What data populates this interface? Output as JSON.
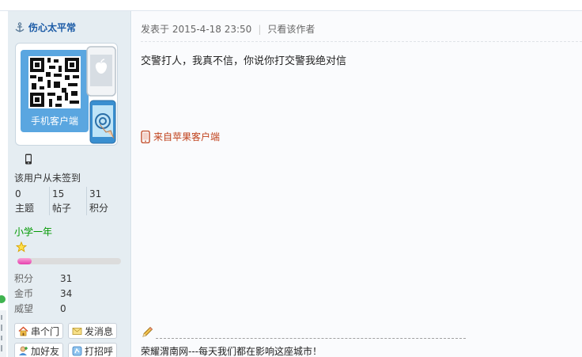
{
  "author": {
    "name": "伤心太平常",
    "icon": "anchor-icon"
  },
  "qr": {
    "label": "手机客户端"
  },
  "user": {
    "signin_text": "该用户从未签到",
    "stats": [
      {
        "value": "0",
        "label": "主题"
      },
      {
        "value": "15",
        "label": "帖子"
      },
      {
        "value": "31",
        "label": "积分"
      }
    ],
    "rank": "小学一年",
    "progress_fraction": 0.14,
    "info": [
      {
        "key": "积分",
        "value": "31"
      },
      {
        "key": "金币",
        "value": "34"
      },
      {
        "key": "威望",
        "value": "0"
      }
    ],
    "buttons": [
      {
        "label": "串个门",
        "icon": "home-icon"
      },
      {
        "label": "发消息",
        "icon": "message-icon"
      },
      {
        "label": "加好友",
        "icon": "add-friend-icon"
      },
      {
        "label": "打招呼",
        "icon": "greet-icon"
      }
    ]
  },
  "post": {
    "posted_at": "发表于 2015-4-18 23:50",
    "separator": "|",
    "only_author": "只看该作者",
    "content": "交警打人，我真不信，你说你打交警我绝对信",
    "from_client": "来自苹果客户端",
    "signature": "荣耀渭南网---每天我们都在影响这座城市！"
  },
  "colors": {
    "author_name": "#1a5aa6",
    "rank": "#009900",
    "from_client": "#c0421c",
    "sidebar_bg": "#e5edf2",
    "progress_fill": "#e53fae"
  }
}
